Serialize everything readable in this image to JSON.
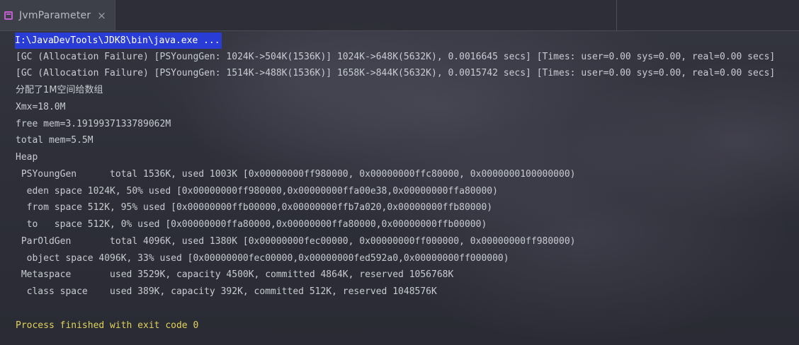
{
  "tab": {
    "title": "JvmParameter",
    "close": "×"
  },
  "console": {
    "command": "I:\\JavaDevTools\\JDK8\\bin\\java.exe ...",
    "lines": [
      "[GC (Allocation Failure) [PSYoungGen: 1024K->504K(1536K)] 1024K->648K(5632K), 0.0016645 secs] [Times: user=0.00 sys=0.00, real=0.00 secs]",
      "[GC (Allocation Failure) [PSYoungGen: 1514K->488K(1536K)] 1658K->844K(5632K), 0.0015742 secs] [Times: user=0.00 sys=0.00, real=0.00 secs]",
      "分配了1M空间给数组",
      "Xmx=18.0M",
      "free mem=3.1919937133789062M",
      "total mem=5.5M",
      "Heap",
      " PSYoungGen      total 1536K, used 1003K [0x00000000ff980000, 0x00000000ffc80000, 0x0000000100000000)",
      "  eden space 1024K, 50% used [0x00000000ff980000,0x00000000ffa00e38,0x00000000ffa80000)",
      "  from space 512K, 95% used [0x00000000ffb00000,0x00000000ffb7a020,0x00000000ffb80000)",
      "  to   space 512K, 0% used [0x00000000ffa80000,0x00000000ffa80000,0x00000000ffb00000)",
      " ParOldGen       total 4096K, used 1380K [0x00000000fec00000, 0x00000000ff000000, 0x00000000ff980000)",
      "  object space 4096K, 33% used [0x00000000fec00000,0x00000000fed592a0,0x00000000ff000000)",
      " Metaspace       used 3529K, capacity 4500K, committed 4864K, reserved 1056768K",
      "  class space    used 389K, capacity 392K, committed 512K, reserved 1048576K",
      "",
      "Process finished with exit code 0"
    ]
  },
  "colors": {
    "command_highlight": "#2a3cd6",
    "exit_text": "#e0d35a",
    "text": "#c9cbd3",
    "tab_icon": "#c45fd0"
  }
}
